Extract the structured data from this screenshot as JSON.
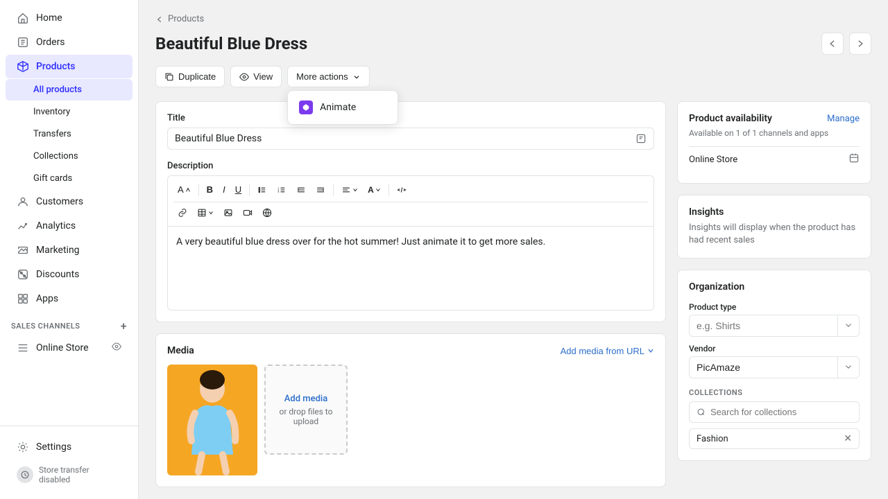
{
  "sidebar": {
    "items": [
      {
        "id": "home",
        "label": "Home",
        "icon": "home",
        "active": false
      },
      {
        "id": "orders",
        "label": "Orders",
        "icon": "orders",
        "active": false
      },
      {
        "id": "products",
        "label": "Products",
        "icon": "products",
        "active": true
      }
    ],
    "sub_items": [
      {
        "id": "all-products",
        "label": "All products",
        "active": true
      },
      {
        "id": "inventory",
        "label": "Inventory",
        "active": false
      },
      {
        "id": "transfers",
        "label": "Transfers",
        "active": false
      },
      {
        "id": "collections",
        "label": "Collections",
        "active": false
      },
      {
        "id": "gift-cards",
        "label": "Gift cards",
        "active": false
      }
    ],
    "bottom_items": [
      {
        "id": "customers",
        "label": "Customers",
        "icon": "customers"
      },
      {
        "id": "analytics",
        "label": "Analytics",
        "icon": "analytics"
      },
      {
        "id": "marketing",
        "label": "Marketing",
        "icon": "marketing"
      },
      {
        "id": "discounts",
        "label": "Discounts",
        "icon": "discounts"
      },
      {
        "id": "apps",
        "label": "Apps",
        "icon": "apps"
      }
    ],
    "sales_channels_label": "SALES CHANNELS",
    "sales_channels": [
      {
        "id": "online-store",
        "label": "Online Store"
      }
    ],
    "footer_items": [
      {
        "id": "settings",
        "label": "Settings"
      },
      {
        "id": "store-transfer",
        "label": "Store transfer disabled"
      }
    ]
  },
  "breadcrumb": {
    "label": "Products",
    "icon": "chevron-left"
  },
  "page": {
    "title": "Beautiful Blue Dress"
  },
  "toolbar": {
    "duplicate_label": "Duplicate",
    "view_label": "View",
    "more_actions_label": "More actions",
    "dropdown_items": [
      {
        "id": "animate",
        "label": "Animate",
        "icon": "animate-icon"
      }
    ]
  },
  "product_form": {
    "title_label": "Title",
    "title_value": "Beautiful Blue Dress",
    "description_label": "Description",
    "description_text": "A very beautiful blue dress over for the hot summer! Just animate it to get more sales."
  },
  "editor": {
    "buttons": [
      "A",
      "B",
      "I",
      "U",
      "list-ul",
      "list-ol",
      "indent-left",
      "indent-right",
      "align",
      "font-color",
      "code",
      "link",
      "table",
      "image",
      "video",
      "embed"
    ]
  },
  "media": {
    "title": "Media",
    "add_url_label": "Add media from URL",
    "upload_label": "Add media",
    "upload_sub": "or drop files to\nupload"
  },
  "right_panel": {
    "availability": {
      "title": "Product availability",
      "manage_label": "Manage",
      "subtitle": "Available on 1 of 1 channels and apps",
      "channels": [
        {
          "id": "online-store",
          "name": "Online Store",
          "icon": "calendar"
        }
      ]
    },
    "insights": {
      "title": "Insights",
      "text": "Insights will display when the product has had recent sales"
    },
    "organization": {
      "title": "Organization",
      "product_type_label": "Product type",
      "product_type_placeholder": "e.g. Shirts",
      "vendor_label": "Vendor",
      "vendor_value": "PicAmaze",
      "collections_label": "COLLECTIONS",
      "collections_search_placeholder": "Search for collections",
      "collections_tags": [
        {
          "id": "fashion",
          "name": "Fashion"
        }
      ]
    }
  }
}
